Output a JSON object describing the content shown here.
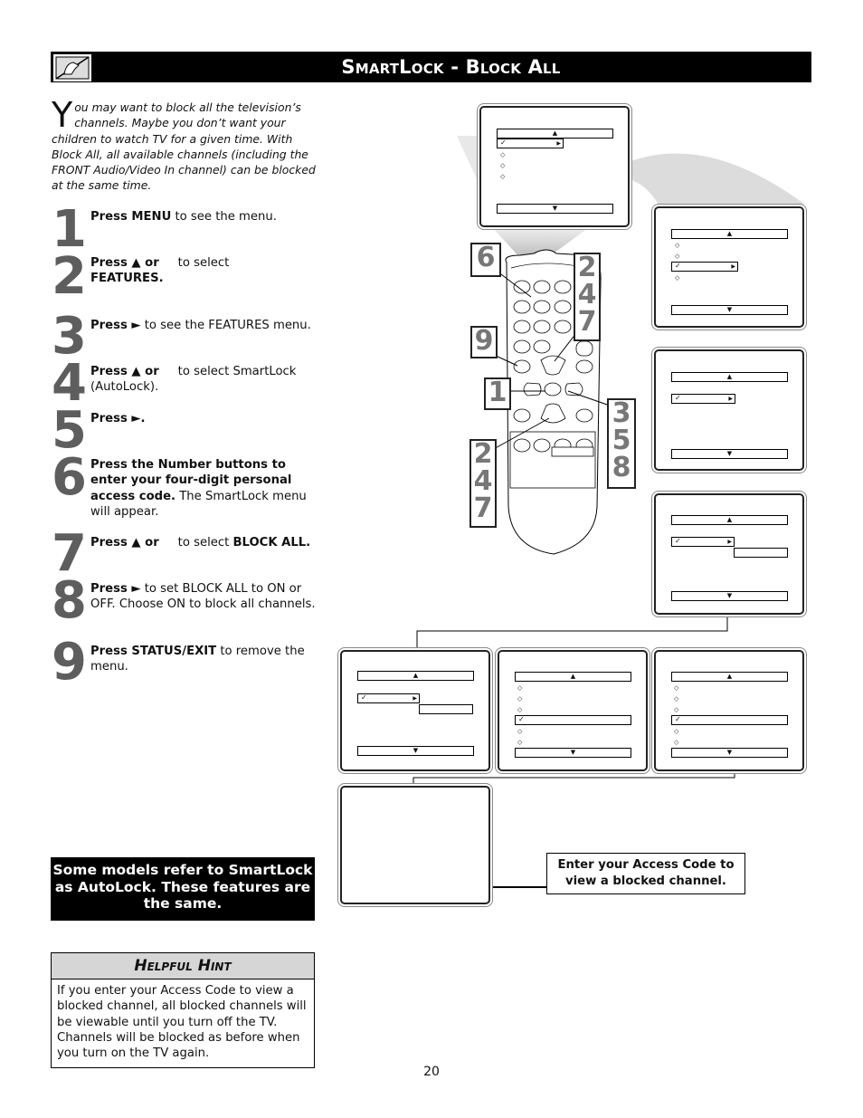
{
  "header": {
    "title": "SmartLock - Block All",
    "icon": "hand-remote-icon"
  },
  "intro": {
    "dropcap": "Y",
    "text": "ou may want to block all the television’s channels. Maybe you don’t want your children to watch TV for a given time. With Block All, all available channels (including the FRONT Audio/Video In channel) can be blocked at the same time."
  },
  "steps": [
    {
      "num": "1",
      "bold": "Press MENU",
      "rest": " to see the menu."
    },
    {
      "num": "2",
      "bold": "Press ▲ or",
      "rest": "     to select ",
      "bold2": "FEATURES."
    },
    {
      "num": "3",
      "bold": "Press ►",
      "rest": " to see the FEATURES menu."
    },
    {
      "num": "4",
      "bold": "Press ▲ or",
      "rest": "     to select SmartLock (AutoLock)."
    },
    {
      "num": "5",
      "bold": "Press ►.",
      "rest": ""
    },
    {
      "num": "6",
      "bold": "Press the Number buttons to enter your four-digit personal access code.",
      "rest": " The SmartLock menu will appear."
    },
    {
      "num": "7",
      "bold": "Press ▲ or",
      "rest": "     to select ",
      "bold2": "BLOCK ALL."
    },
    {
      "num": "8",
      "bold": "Press ►",
      "rest": " to set BLOCK ALL to ON or OFF.  Choose ON to block all channels."
    },
    {
      "num": "9",
      "bold": "Press STATUS/EXIT",
      "rest": " to remove the menu."
    }
  ],
  "note": "Some models refer to SmartLock as AutoLock. These features are the same.",
  "hint": {
    "title": "Helpful Hint",
    "body": "If you enter your Access Code to view a blocked channel,  all blocked channels will be viewable until you turn off the TV. Channels will be blocked as before when you turn on the TV again."
  },
  "callout": "Enter your Access Code to view a blocked channel.",
  "remote_callouts": {
    "left_top": "6",
    "left_mid": "9",
    "center": "1",
    "up_stack": [
      "2",
      "4",
      "7"
    ],
    "down_stack": [
      "2",
      "4",
      "7"
    ],
    "right_stack": [
      "3",
      "5",
      "8"
    ]
  },
  "glyphs": {
    "up": "▲",
    "down": "▼",
    "right": "▶",
    "check": "✓",
    "diamond": "◇"
  },
  "page_number": "20"
}
